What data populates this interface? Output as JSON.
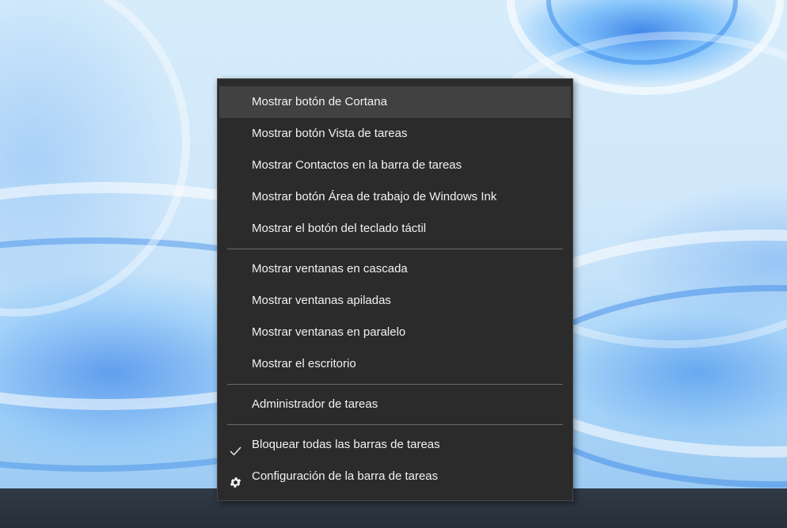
{
  "context_menu": {
    "groups": [
      {
        "items": [
          {
            "label": "Mostrar botón de Cortana",
            "highlighted": true
          },
          {
            "label": "Mostrar botón Vista de tareas"
          },
          {
            "label": "Mostrar Contactos en la barra de tareas"
          },
          {
            "label": "Mostrar botón Área de trabajo de Windows Ink"
          },
          {
            "label": "Mostrar el botón del teclado táctil"
          }
        ]
      },
      {
        "items": [
          {
            "label": "Mostrar ventanas en cascada"
          },
          {
            "label": "Mostrar ventanas apiladas"
          },
          {
            "label": "Mostrar ventanas en paralelo"
          },
          {
            "label": "Mostrar el escritorio"
          }
        ]
      },
      {
        "items": [
          {
            "label": "Administrador de tareas"
          }
        ]
      },
      {
        "items": [
          {
            "label": "Bloquear todas las barras de tareas",
            "icon": "checkmark-icon",
            "checked": true
          },
          {
            "label": "Configuración de la barra de tareas",
            "icon": "gear-icon"
          }
        ]
      }
    ]
  },
  "colors": {
    "menu_background": "#2b2b2b",
    "menu_highlight": "#414141",
    "menu_text": "#f2f2f2",
    "separator": "#6b6b6b",
    "taskbar": "#2b3640"
  }
}
